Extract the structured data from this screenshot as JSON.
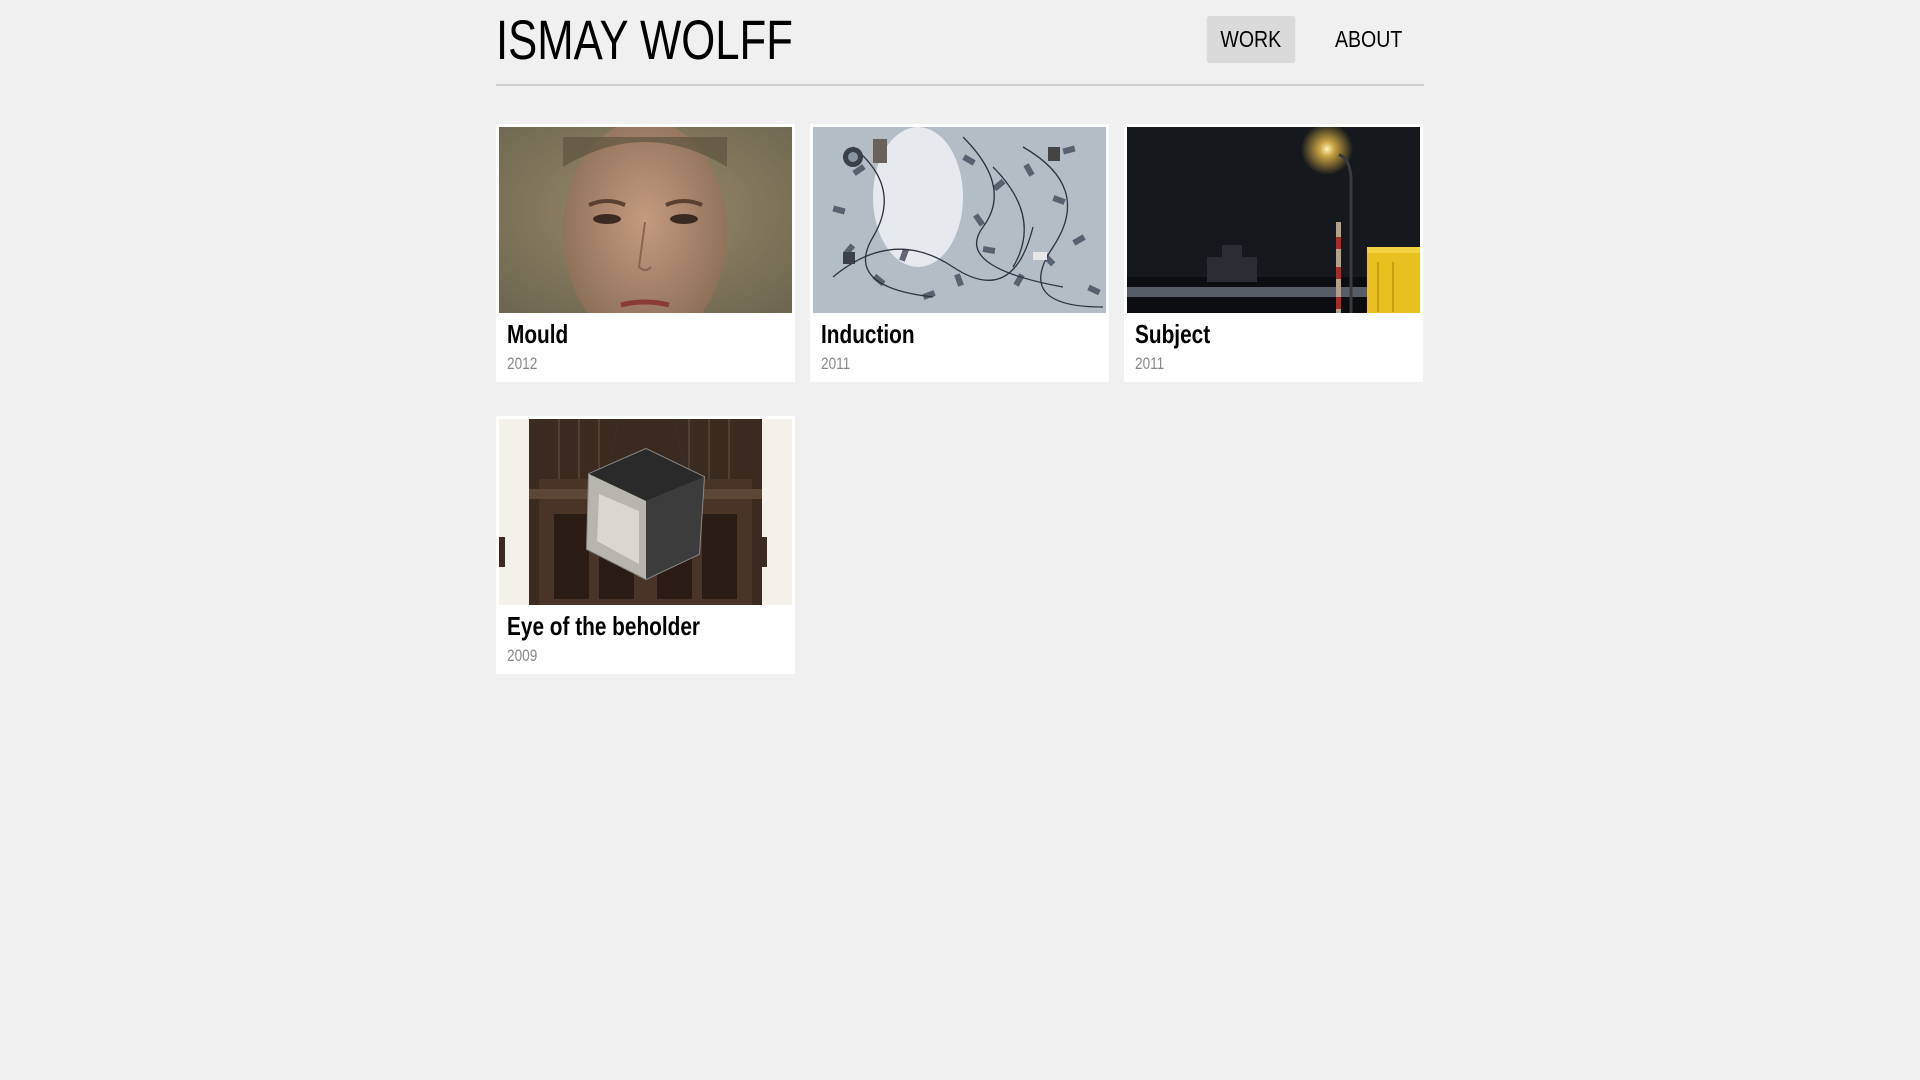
{
  "site": {
    "title": "ISMAY WOLFF"
  },
  "nav": [
    {
      "label": "WORK",
      "active": true
    },
    {
      "label": "ABOUT",
      "active": false
    }
  ],
  "works": [
    {
      "title": "Mould",
      "year": "2012",
      "image": "face-portrait"
    },
    {
      "title": "Induction",
      "year": "2011",
      "image": "wired-devices-on-floor"
    },
    {
      "title": "Subject",
      "year": "2011",
      "image": "night-street-lamp"
    },
    {
      "title": "Eye of the beholder",
      "year": "2009",
      "image": "mirror-cube-in-church"
    }
  ]
}
